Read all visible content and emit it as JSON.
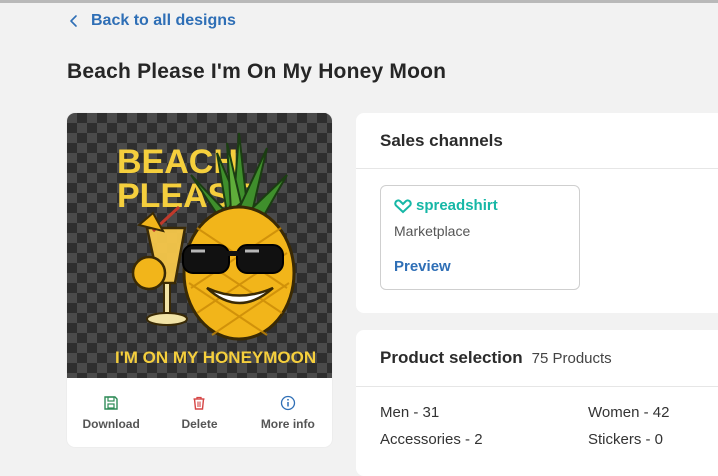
{
  "nav": {
    "back_label": "Back to all designs"
  },
  "design": {
    "title": "Beach Please I'm On My Honey Moon",
    "artwork_text_top": [
      "BEACH",
      "PLEASE"
    ],
    "artwork_text_bottom": "I'M ON MY HONEYMOON",
    "actions": {
      "download": "Download",
      "delete": "Delete",
      "more_info": "More info"
    }
  },
  "sales_channels": {
    "title": "Sales channels",
    "channel": {
      "brand": "spreadshirt",
      "type": "Marketplace",
      "preview": "Preview"
    }
  },
  "product_selection": {
    "title": "Product selection",
    "count": "75 Products",
    "categories": [
      {
        "label": "Men - 31"
      },
      {
        "label": "Women - 42"
      },
      {
        "label": "Accessories - 2"
      },
      {
        "label": "Stickers - 0"
      }
    ]
  },
  "colors": {
    "link": "#2f6fb6",
    "brand_teal": "#16b7a6",
    "download_icon": "#2e8b57",
    "delete_icon": "#d64545",
    "info_icon": "#2f6fb6"
  }
}
